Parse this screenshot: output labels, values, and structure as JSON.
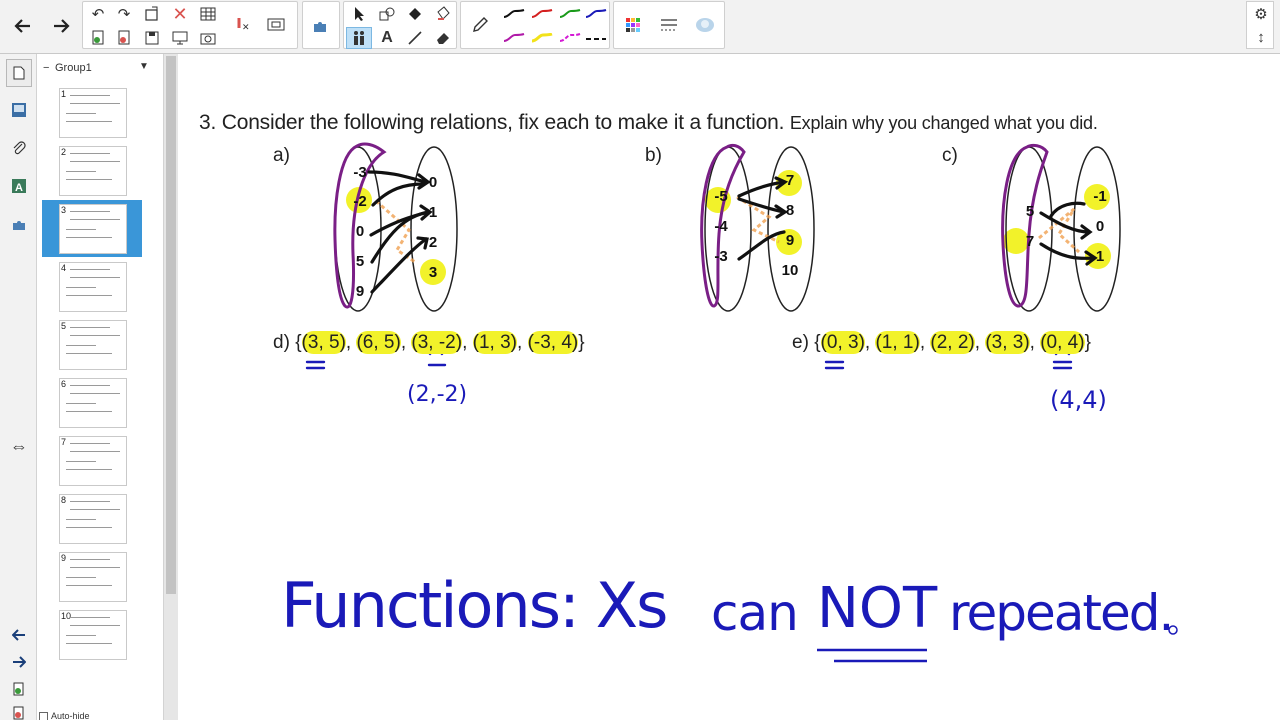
{
  "group": {
    "name": "Group1"
  },
  "thumbnails": [
    {
      "num": "1"
    },
    {
      "num": "2"
    },
    {
      "num": "3",
      "selected": true
    },
    {
      "num": "4"
    },
    {
      "num": "5"
    },
    {
      "num": "6"
    },
    {
      "num": "7"
    },
    {
      "num": "8"
    },
    {
      "num": "9"
    },
    {
      "num": "10"
    }
  ],
  "sorter": {
    "autohide_label": "Auto-hide"
  },
  "question": {
    "main": "3. Consider the following relations, fix each to make it a function.",
    "rest": "Explain why you changed what you did."
  },
  "diagrams": {
    "a": {
      "label": "a)",
      "domain": [
        "-3",
        "-2",
        "0",
        "5",
        "9"
      ],
      "range": [
        "0",
        "1",
        "2",
        "3"
      ]
    },
    "b": {
      "label": "b)",
      "domain": [
        "-5",
        "-4",
        "-3"
      ],
      "range": [
        "7",
        "8",
        "9",
        "10"
      ]
    },
    "c": {
      "label": "c)",
      "domain": [
        "5",
        "7"
      ],
      "range": [
        "-1",
        "0",
        "1"
      ]
    }
  },
  "sets": {
    "d": {
      "label": "d)",
      "pairs": [
        "(3, 5)",
        "(6, 5)",
        "(3, -2)",
        "(1, 3)",
        "(-3, 4)"
      ],
      "correction": "(2,-2)"
    },
    "e": {
      "label": "e)",
      "pairs": [
        "(0, 3)",
        "(1, 1)",
        "(2, 2)",
        "(3, 3)",
        "(0, 4)"
      ],
      "correction": "(4,4)"
    }
  },
  "handwriting": {
    "part1": "Functions: Xs",
    "part2": "can",
    "part3": "NOT",
    "part4": "repeated."
  },
  "colors": {
    "highlight": "#f2f22a",
    "ink_blue": "#1a1ab8",
    "ink_purple": "#7a1f86",
    "ink_black": "#111111",
    "selection": "#3a96d8"
  }
}
